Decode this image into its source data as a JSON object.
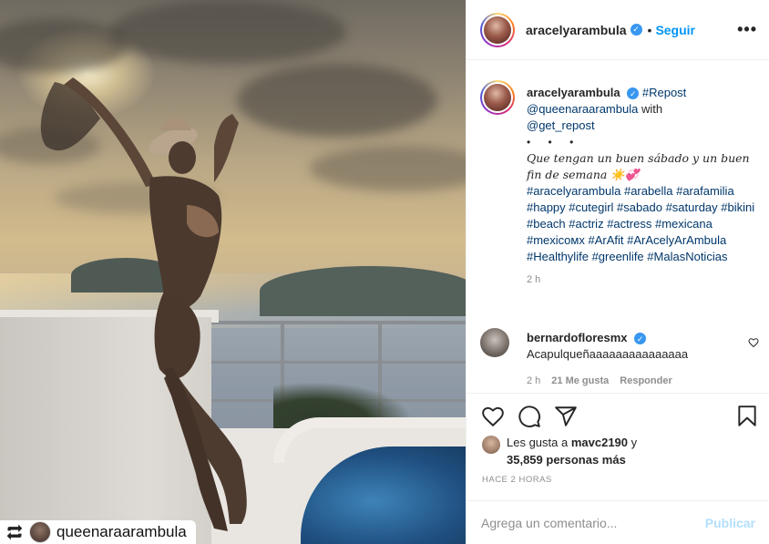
{
  "post": {
    "username": "aracelyarambula",
    "follow_label": "Seguir",
    "separator": "•",
    "more_label": "•••",
    "reposted_from": "queenaraarambula"
  },
  "caption": {
    "username": "aracelyarambula",
    "repost_tag": "#Repost",
    "mention": "@queenaraarambula",
    "with_word": "with",
    "get_repost": "@get_repost",
    "dots": "• • •",
    "message": "Que tengan un buen sábado y un buen fin de semana ☀️💞",
    "hashtags": [
      "#aracelyarambula",
      "#arabella",
      "#arafamilia",
      "#happy",
      "#cutegirl",
      "#sabado",
      "#saturday",
      "#bikini",
      "#beach",
      "#actriz",
      "#actress",
      "#mexicana",
      "#mexicoмx",
      "#ArAfit",
      "#ArAcelyArAmbula",
      "#Healthylife",
      "#greenlife",
      "#MalasNoticias"
    ],
    "time": "2 h"
  },
  "comment": {
    "username": "bernardofloresmx",
    "text": "Acapulqueñaaaaaaaaaaaaaaa",
    "time": "2 h",
    "likes": "21 Me gusta",
    "reply_label": "Responder"
  },
  "likes": {
    "prefix": "Les gusta a",
    "liker": "mavc2190",
    "connector": "y",
    "others": "35,859 personas más"
  },
  "timestamp": "HACE 2 HORAS",
  "add_comment": {
    "placeholder": "Agrega un comentario...",
    "post_label": "Publicar"
  },
  "colors": {
    "link_blue": "#0095f6",
    "hashtag": "#00376b",
    "muted": "#8e8e8e",
    "post_disabled": "#b2dffc",
    "verified": "#3897f0"
  }
}
